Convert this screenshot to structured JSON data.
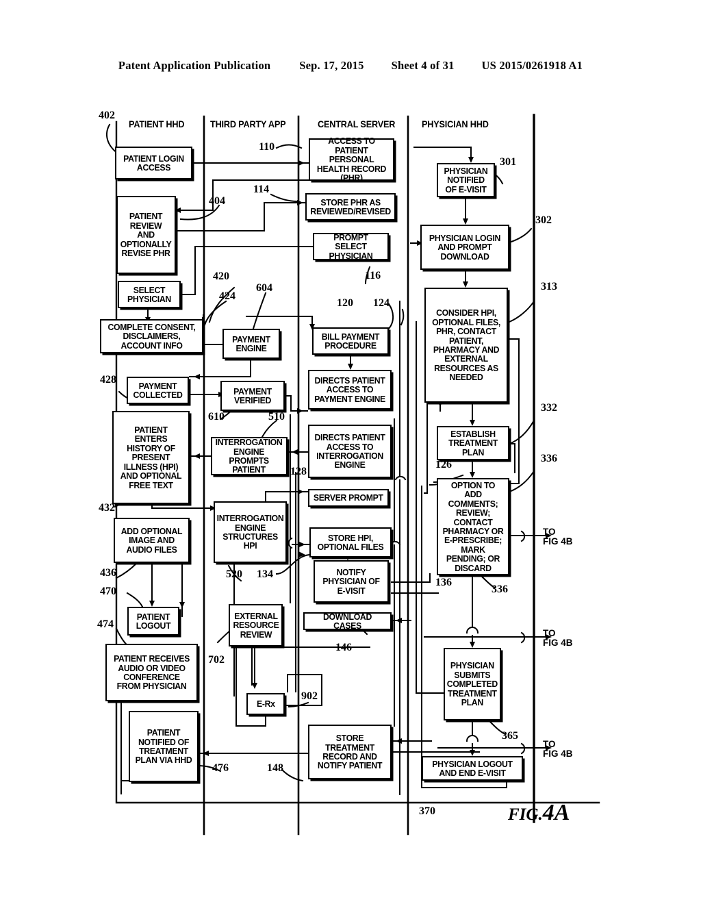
{
  "header": {
    "publication": "Patent Application Publication",
    "date": "Sep. 17, 2015",
    "sheet": "Sheet 4 of 31",
    "patent_number": "US 2015/0261918 A1"
  },
  "figure": {
    "prefix": "FIG.",
    "number": "4A"
  },
  "lanes": [
    {
      "id": "patient-hhd",
      "label": "PATIENT HHD"
    },
    {
      "id": "third-party-app",
      "label": "THIRD PARTY APP"
    },
    {
      "id": "central-server",
      "label": "CENTRAL SERVER"
    },
    {
      "id": "physician-hhd",
      "label": "PHYSICIAN HHD"
    }
  ],
  "boxes": {
    "patient_login_access": "PATIENT LOGIN ACCESS",
    "patient_review_revise_phr": "PATIENT REVIEW AND OPTIONALLY REVISE PHR",
    "select_physician": "SELECT PHYSICIAN",
    "complete_consent": "COMPLETE CONSENT, DISCLAIMERS, ACCOUNT INFO",
    "payment_collected": "PAYMENT COLLECTED",
    "patient_enters_hpi": "PATIENT ENTERS HISTORY OF PRESENT ILLNESS (HPI) AND OPTIONAL FREE TEXT",
    "add_optional_files": "ADD OPTIONAL IMAGE AND AUDIO FILES",
    "patient_logout": "PATIENT LOGOUT",
    "patient_receives_conference": "PATIENT RECEIVES AUDIO OR VIDEO CONFERENCE FROM PHYSICIAN",
    "patient_notified_plan": "PATIENT NOTIFIED OF TREATMENT PLAN VIA HHD",
    "payment_engine": "PAYMENT ENGINE",
    "payment_verified": "PAYMENT VERIFIED",
    "interrogation_prompts": "INTERROGATION ENGINE PROMPTS PATIENT",
    "interrogation_structures": "INTERROGATION ENGINE STRUCTURES HPI",
    "external_resource_review": "EXTERNAL RESOURCE REVIEW",
    "erx": "E-Rx",
    "access_phr": "ACCESS TO PATIENT PERSONAL HEALTH RECORD (PHR)",
    "store_phr": "STORE PHR AS REVIEWED/REVISED",
    "prompt_select_physician": "PROMPT SELECT PHYSICIAN",
    "bill_payment_procedure": "BILL PAYMENT PROCEDURE",
    "directs_payment_engine": "DIRECTS PATIENT ACCESS TO PAYMENT ENGINE",
    "directs_interrogation": "DIRECTS PATIENT ACCESS TO INTERROGATION ENGINE",
    "server_prompt": "SERVER PROMPT",
    "store_hpi": "STORE HPI, OPTIONAL FILES",
    "notify_physician": "NOTIFY PHYSICIAN OF E-VISIT",
    "download_cases": "DOWNLOAD CASES",
    "store_treatment_record": "STORE TREATMENT RECORD AND NOTIFY PATIENT",
    "physician_notified": "PHYSICIAN NOTIFIED OF E-VISIT",
    "physician_login": "PHYSICIAN LOGIN AND PROMPT DOWNLOAD",
    "consider_hpi": "CONSIDER HPI, OPTIONAL FILES, PHR, CONTACT PATIENT, PHARMACY AND EXTERNAL RESOURCES AS NEEDED",
    "establish_treatment_plan": "ESTABLISH TREATMENT PLAN",
    "option_to_add": "OPTION TO ADD COMMENTS; REVIEW; CONTACT PHARMACY OR E-PRESCRIBE; MARK PENDING; OR DISCARD",
    "physician_submits_plan": "PHYSICIAN SUBMITS COMPLETED TREATMENT PLAN",
    "physician_logout": "PHYSICIAN LOGOUT AND END E-VISIT"
  },
  "refs": {
    "r402": "402",
    "r404": "404",
    "r420": "420",
    "r424": "424",
    "r428": "428",
    "r432": "432",
    "r436": "436",
    "r470": "470",
    "r474": "474",
    "r476": "476",
    "r604": "604",
    "r610": "610",
    "r510": "510",
    "r520": "520",
    "r702": "702",
    "r902": "902",
    "r110": "110",
    "r114": "114",
    "r116": "116",
    "r120": "120",
    "r124": "124",
    "r126": "126",
    "r128": "128",
    "r134": "134",
    "r136": "136",
    "r146": "146",
    "r148": "148",
    "r301": "301",
    "r302": "302",
    "r313": "313",
    "r332": "332",
    "r336a": "336",
    "r336b": "336",
    "r365": "365",
    "r370": "370"
  },
  "offpage": [
    {
      "id": "to-fig-4b-1",
      "line1": "TO",
      "line2": "FIG 4B"
    },
    {
      "id": "to-fig-4b-2",
      "line1": "TO",
      "line2": "FIG 4B"
    },
    {
      "id": "to-fig-4b-3",
      "line1": "TO",
      "line2": "FIG 4B"
    }
  ]
}
